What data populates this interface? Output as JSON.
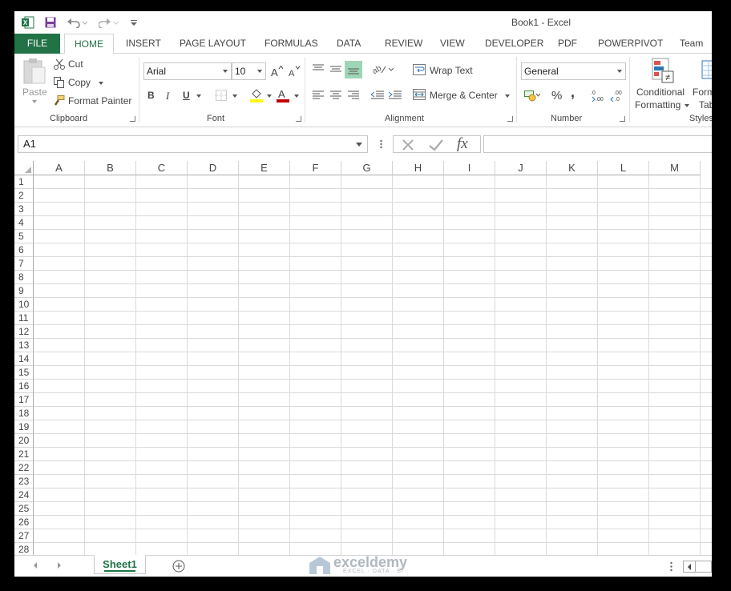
{
  "window": {
    "title": "Book1 - Excel"
  },
  "tabs": [
    "FILE",
    "HOME",
    "INSERT",
    "PAGE LAYOUT",
    "FORMULAS",
    "DATA",
    "REVIEW",
    "VIEW",
    "DEVELOPER",
    "PDF",
    "POWERPIVOT",
    "Team"
  ],
  "clipboard": {
    "paste": "Paste",
    "cut": "Cut",
    "copy": "Copy",
    "format_painter": "Format Painter",
    "label": "Clipboard"
  },
  "font": {
    "name": "Arial",
    "size": "10",
    "bold": "B",
    "italic": "I",
    "underline": "U",
    "label": "Font"
  },
  "alignment": {
    "wrap_text": "Wrap Text",
    "merge_center": "Merge & Center",
    "label": "Alignment"
  },
  "number": {
    "format": "General",
    "percent": "%",
    "comma": ",",
    "label": "Number"
  },
  "styles": {
    "conditional_formatting_1": "Conditional",
    "conditional_formatting_2": "Formatting",
    "format_as_table_1": "Form",
    "format_as_table_2": "Tab",
    "label": "Styles"
  },
  "formula_bar": {
    "name_box": "A1",
    "fx": "fx",
    "formula": ""
  },
  "grid": {
    "columns": [
      "A",
      "B",
      "C",
      "D",
      "E",
      "F",
      "G",
      "H",
      "I",
      "J",
      "K",
      "L",
      "M"
    ],
    "rows": [
      "1",
      "2",
      "3",
      "4",
      "5",
      "6",
      "7",
      "8",
      "9",
      "10",
      "11",
      "12",
      "13",
      "14",
      "15",
      "16",
      "17",
      "18",
      "19",
      "20",
      "21",
      "22",
      "23",
      "24",
      "25",
      "26",
      "27",
      "28"
    ]
  },
  "sheets": {
    "active": "Sheet1"
  },
  "watermark": {
    "brand": "exceldemy",
    "tagline": "EXCEL · DATA · BI"
  },
  "colors": {
    "excel_green": "#217346",
    "fill_yellow": "#ffff00",
    "font_red": "#c00000"
  }
}
